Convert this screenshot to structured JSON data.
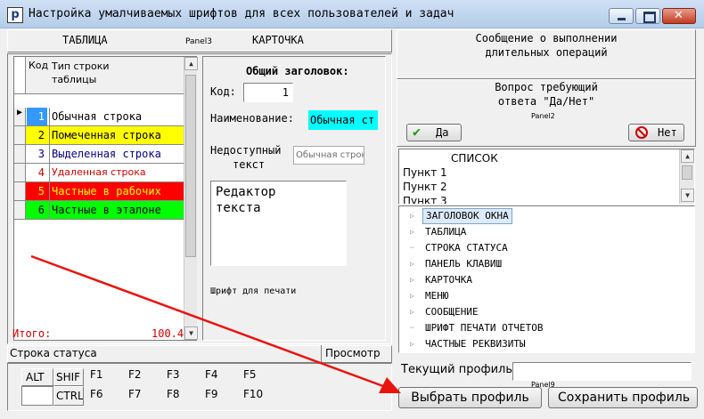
{
  "window": {
    "icon_letter": "p",
    "title": "Настройка умалчиваемых шрифтов для всех пользователей и задач"
  },
  "headers": {
    "table": "ТАБЛИЦА",
    "panel3": "Panel3",
    "card": "КАРТОЧКА"
  },
  "grid": {
    "col_code": "Код",
    "col_type": "Тип строки таблицы",
    "rows": [
      {
        "code": "1",
        "name": "Обычная строка",
        "bg": "#ffffff",
        "fg": "#000000",
        "code_bg": "#3399ff",
        "code_fg": "#ffffff"
      },
      {
        "code": "2",
        "name": "Помеченная строка",
        "bg": "#ffff00",
        "fg": "#000000",
        "code_bg": "#ffff00",
        "code_fg": "#000000"
      },
      {
        "code": "3",
        "name": "Выделенная строка",
        "bg": "#ffffff",
        "fg": "#000080",
        "code_bg": "#ffffff",
        "code_fg": "#000080"
      },
      {
        "code": "4",
        "name": "Удаленная строка",
        "bg": "#ffffff",
        "fg": "#cc0000",
        "code_bg": "#ffffff",
        "code_fg": "#cc0000"
      },
      {
        "code": "5",
        "name": "Частные в рабочих",
        "bg": "#ff0000",
        "fg": "#ffff00",
        "code_bg": "#ff0000",
        "code_fg": "#ffff00"
      },
      {
        "code": "6",
        "name": "Частные в эталоне",
        "bg": "#00ff00",
        "fg": "#000000",
        "code_bg": "#00ff00",
        "code_fg": "#000000"
      }
    ],
    "footer_label": "Итого:",
    "footer_value": "100.4"
  },
  "card": {
    "general_header": "Общий заголовок:",
    "code_label": "Код:",
    "code_value": "1",
    "name_label": "Наименование:",
    "name_value": "Обычная ст",
    "unavailable_label_1": "Недоступный",
    "unavailable_label_2": "текст",
    "unavailable_value": "Обычная строк",
    "editor_text_1": "Редактор",
    "editor_text_2": "текста",
    "print_font": "Шрифт для печати"
  },
  "status": {
    "label": "Строка статуса",
    "preview": "Просмотр",
    "keys": {
      "alt": "ALT",
      "shift": "SHIF",
      "ctrl": "CTRL"
    },
    "fkeys_top": [
      "F1",
      "F2",
      "F3",
      "F4",
      "F5"
    ],
    "fkeys_bottom": [
      "F6",
      "F7",
      "F8",
      "F9",
      "F10"
    ]
  },
  "message": {
    "title_1": "Сообщение о выполнении",
    "title_2": "длительных операций",
    "question_1": "Вопрос требующий",
    "question_2": "ответа \"Да/Нет\"",
    "panel2": "Panel2",
    "yes": "Да",
    "no": "Нет"
  },
  "list": {
    "header": "СПИСОК",
    "items": [
      "Пункт 1",
      "Пункт 2",
      "Пункт 3"
    ]
  },
  "tree": {
    "items": [
      {
        "label": "ЗАГОЛОВОК ОКНА",
        "expandable": true,
        "selected": true
      },
      {
        "label": "ТАБЛИЦА",
        "expandable": true,
        "selected": false
      },
      {
        "label": "СТРОКА СТАТУСА",
        "expandable": false,
        "selected": false
      },
      {
        "label": "ПАНЕЛЬ КЛАВИШ",
        "expandable": true,
        "selected": false
      },
      {
        "label": "КАРТОЧКА",
        "expandable": true,
        "selected": false
      },
      {
        "label": "МЕНЮ",
        "expandable": true,
        "selected": false
      },
      {
        "label": "СООБЩЕНИЕ",
        "expandable": true,
        "selected": false
      },
      {
        "label": "ШРИФТ ПЕЧАТИ ОТЧЕТОВ",
        "expandable": false,
        "selected": false
      },
      {
        "label": "ЧАСТНЫЕ РЕКВИЗИТЫ",
        "expandable": true,
        "selected": false
      }
    ]
  },
  "profile": {
    "current_label": "Текущий профиль:",
    "current_value": "",
    "panel_label": "Panel9",
    "select_button": "Выбрать профиль",
    "save_button": "Сохранить профиль"
  },
  "colors": {
    "accent_cyan": "#00ffff",
    "selection": "#3399ff",
    "arrow": "#e8140e",
    "title_grad_top": "#cfe0f5"
  }
}
